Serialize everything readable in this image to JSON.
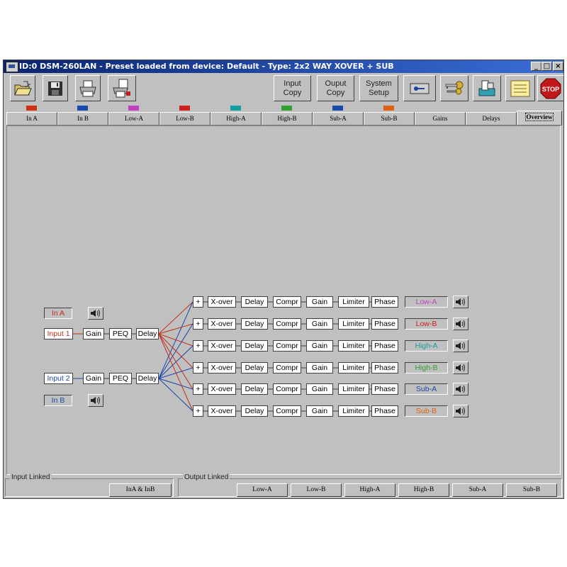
{
  "window": {
    "title": "ID:0 DSM-260LAN - Preset loaded from device: Default - Type: 2x2 WAY XOVER + SUB",
    "minimize": "_",
    "maximize": "□",
    "close": "×"
  },
  "toolbar": {
    "input_copy": [
      "Input",
      "Copy"
    ],
    "output_copy": [
      "Ouput",
      "Copy"
    ],
    "system_setup": [
      "System",
      "Setup"
    ],
    "stop_label": "STOP"
  },
  "tabs": [
    {
      "label": "In A",
      "color": "#d03010"
    },
    {
      "label": "In B",
      "color": "#1848a8"
    },
    {
      "label": "Low-A",
      "color": "#c040c0"
    },
    {
      "label": "Low-B",
      "color": "#d02020"
    },
    {
      "label": "High-A",
      "color": "#10a0a0"
    },
    {
      "label": "High-B",
      "color": "#30a030"
    },
    {
      "label": "Sub-A",
      "color": "#1848a8"
    },
    {
      "label": "Sub-B",
      "color": "#e06010"
    },
    {
      "label": "Gains",
      "color": null
    },
    {
      "label": "Delays",
      "color": null
    },
    {
      "label": "Overview",
      "color": null
    }
  ],
  "overview": {
    "input_channels": {
      "in_a": {
        "label": "In A",
        "color": "#c03018"
      },
      "in_b": {
        "label": "In B",
        "color": "#1848a8"
      }
    },
    "input_chains": [
      {
        "source": "Input 1",
        "color": "#c03018",
        "blocks": [
          "Gain",
          "PEQ",
          "Delay"
        ]
      },
      {
        "source": "Input 2",
        "color": "#1848a8",
        "blocks": [
          "Gain",
          "PEQ",
          "Delay"
        ]
      }
    ],
    "output_chains": [
      {
        "sum": "+",
        "blocks": [
          "X-over",
          "Delay",
          "Compr",
          "Gain",
          "Limiter",
          "Phase"
        ],
        "out": "Low-A",
        "color": "#c040c0"
      },
      {
        "sum": "+",
        "blocks": [
          "X-over",
          "Delay",
          "Compr",
          "Gain",
          "Limiter",
          "Phase"
        ],
        "out": "Low-B",
        "color": "#d02020"
      },
      {
        "sum": "+",
        "blocks": [
          "X-over",
          "Delay",
          "Compr",
          "Gain",
          "Limiter",
          "Phase"
        ],
        "out": "High-A",
        "color": "#10a0a0"
      },
      {
        "sum": "+",
        "blocks": [
          "X-over",
          "Delay",
          "Compr",
          "Gain",
          "Limiter",
          "Phase"
        ],
        "out": "High-B",
        "color": "#30a030"
      },
      {
        "sum": "+",
        "blocks": [
          "X-over",
          "Delay",
          "Compr",
          "Gain",
          "Limiter",
          "Phase"
        ],
        "out": "Sub-A",
        "color": "#1848a8"
      },
      {
        "sum": "+",
        "blocks": [
          "X-over",
          "Delay",
          "Compr",
          "Gain",
          "Limiter",
          "Phase"
        ],
        "out": "Sub-B",
        "color": "#e06010"
      }
    ]
  },
  "bottom": {
    "input_linked_label": "Input Linked",
    "input_linked_button": "InA & InB",
    "output_linked_label": "Output Linked",
    "output_linked_buttons": [
      "Low-A",
      "Low-B",
      "High-A",
      "High-B",
      "Sub-A",
      "Sub-B"
    ]
  }
}
